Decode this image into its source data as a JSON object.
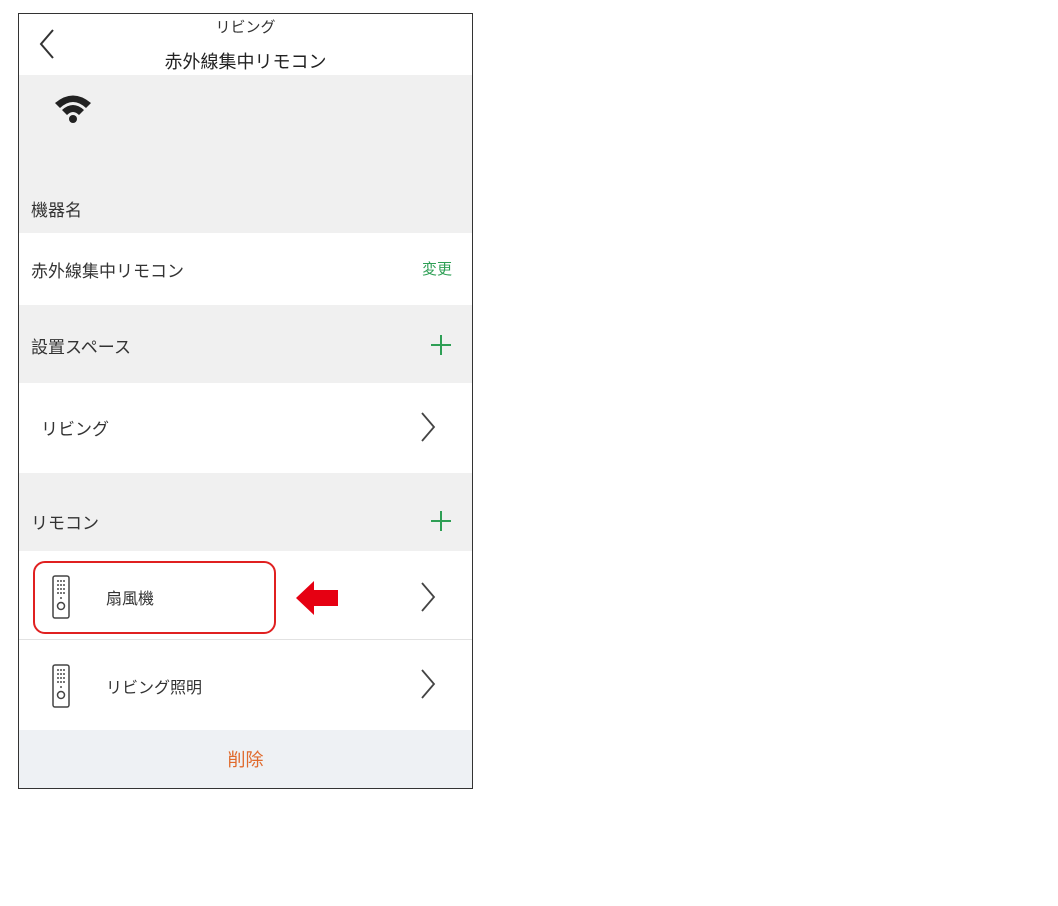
{
  "header": {
    "subtitle": "リビング",
    "title": "赤外線集中リモコン"
  },
  "device_name": {
    "section_label": "機器名",
    "value": "赤外線集中リモコン",
    "change_label": "変更"
  },
  "install_space": {
    "section_label": "設置スペース",
    "items": [
      {
        "label": "リビング"
      }
    ]
  },
  "remotes": {
    "section_label": "リモコン",
    "items": [
      {
        "label": "扇風機"
      },
      {
        "label": "リビング照明"
      }
    ]
  },
  "delete_label": "削除",
  "colors": {
    "accent_green": "#2e9f55",
    "delete_orange": "#e06a2c",
    "highlight_red": "#e02020"
  },
  "icons": {
    "back": "chevron-left-icon",
    "wifi": "wifi-icon",
    "add": "plus-icon",
    "forward": "chevron-right-icon",
    "remote": "remote-control-icon",
    "pointer": "arrow-left-icon"
  }
}
